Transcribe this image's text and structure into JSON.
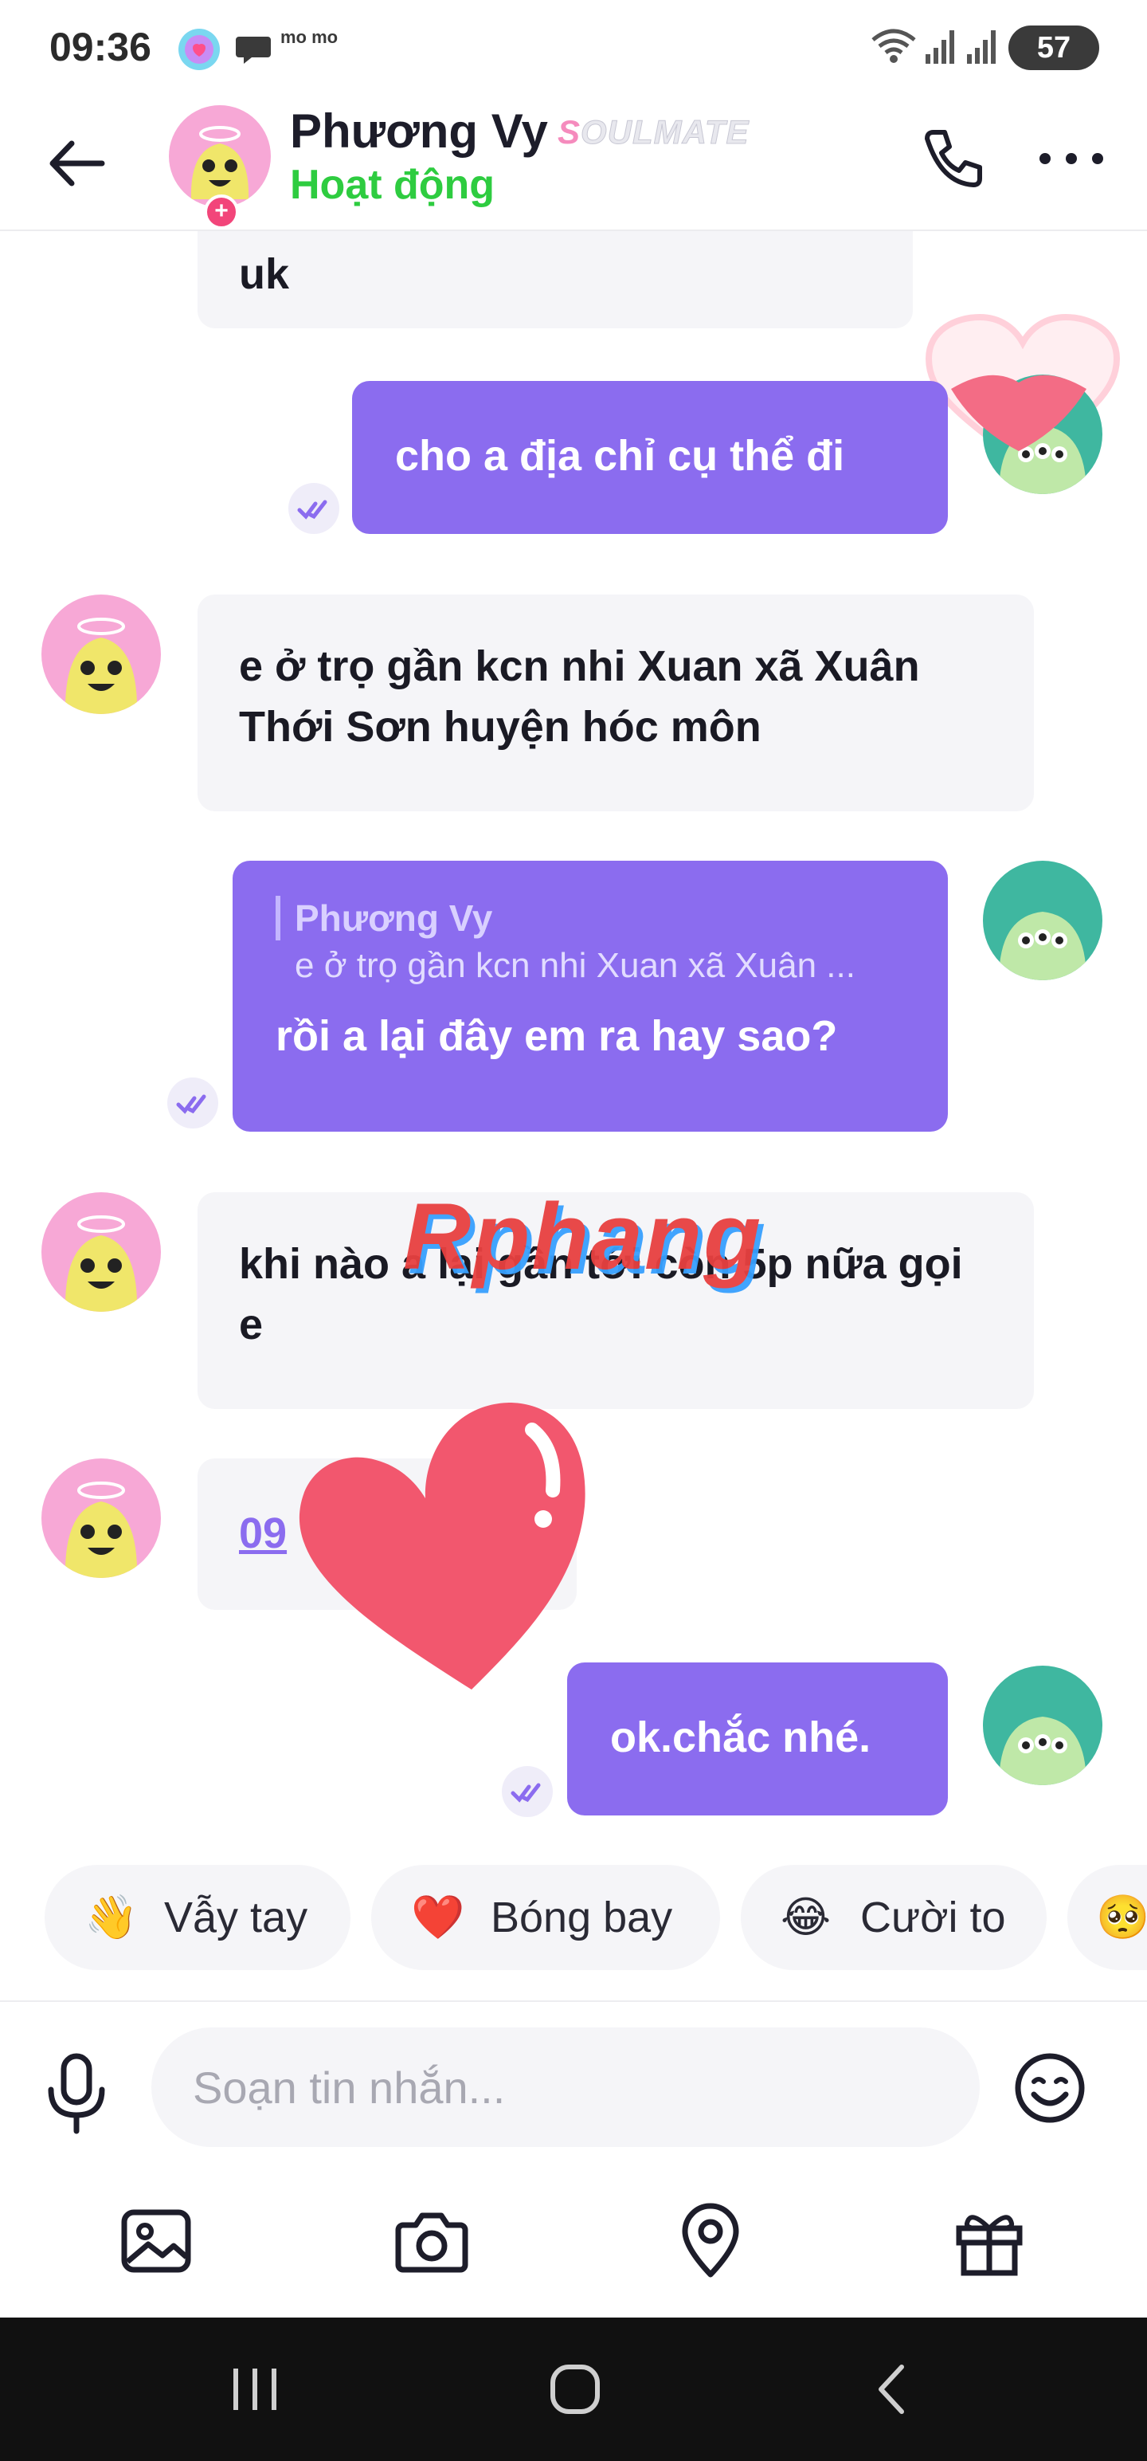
{
  "status_bar": {
    "time": "09:36",
    "notification_icons": [
      "app-icon",
      "chat-bubble-icon",
      "momo-icon"
    ],
    "momo_label": "mo mo",
    "right_icons": [
      "wifi-icon",
      "signal-icon",
      "signal-icon"
    ],
    "battery": "57"
  },
  "header": {
    "contact_name": "Phương Vy",
    "badge": "SOULMATE",
    "badge_first": "S",
    "badge_rest": "OULMATE",
    "status": "Hoạt động",
    "icons": [
      "back-arrow-icon",
      "phone-icon",
      "more-icon"
    ]
  },
  "messages": [
    {
      "dir": "in",
      "text": "uk",
      "avatar": "pink-avatar"
    },
    {
      "dir": "out",
      "text": "cho a địa chỉ cụ thể đi",
      "avatar": "teal-monster-avatar",
      "read": true
    },
    {
      "dir": "in",
      "text": "e ở trọ gần kcn nhi Xuan xã Xuân Thới Sơn huyện hóc môn",
      "avatar": "pink-avatar"
    },
    {
      "dir": "out",
      "reply_to": {
        "name": "Phương Vy",
        "text": "e ở trọ gần kcn nhi Xuan xã Xuân ..."
      },
      "text": "rồi a lại đây em ra hay sao?",
      "read": true
    },
    {
      "dir": "in",
      "text": "khi nào a lại gần tới còn 5p nữa gọi e",
      "avatar": "pink-avatar"
    },
    {
      "dir": "in",
      "text": "09",
      "type": "phone-link",
      "avatar": "pink-avatar"
    },
    {
      "dir": "out",
      "text": "ok.chắc nhé.",
      "read": true
    }
  ],
  "watermark": "Rphang",
  "quick_reactions": [
    {
      "emoji": "👋",
      "label": "Vẫy tay"
    },
    {
      "emoji": "❤️",
      "label": "Bóng bay"
    },
    {
      "emoji": "😂",
      "label": "Cười to"
    },
    {
      "emoji": "🥺",
      "label": ""
    }
  ],
  "composer": {
    "placeholder": "Soạn tin nhắn...",
    "icons": [
      "mic-icon",
      "emoji-icon"
    ],
    "tools": [
      "image-icon",
      "camera-icon",
      "location-icon",
      "gift-icon"
    ]
  },
  "colors": {
    "accent_purple": "#8b6cef",
    "status_green": "#2ecc40",
    "in_bubble": "#f5f5f8",
    "heart_pink": "#f2576e"
  }
}
